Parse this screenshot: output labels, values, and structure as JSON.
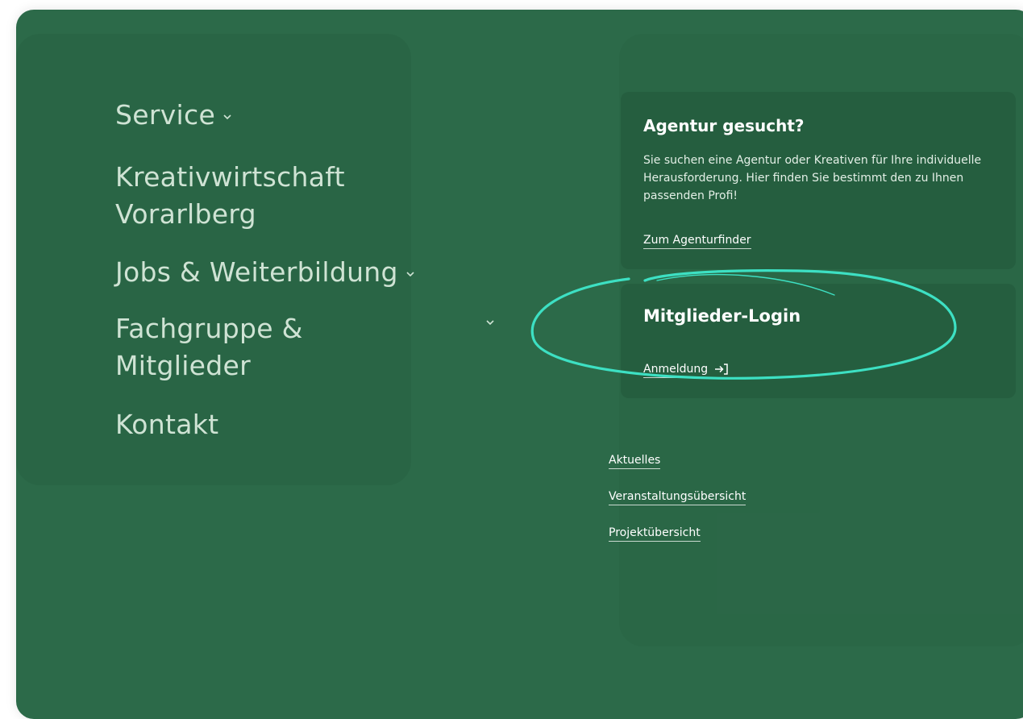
{
  "nav": {
    "service": "Service",
    "kreativwirtschaft": "Kreativwirtschaft Vorarlberg",
    "jobs": "Jobs & Weiterbildung",
    "fachgruppe": "Fachgruppe & Mitglieder",
    "kontakt": "Kontakt"
  },
  "agentur_card": {
    "title": "Agentur gesucht?",
    "text": "Sie suchen eine Agentur oder Kreativen für Ihre individuelle Herausforderung. Hier finden Sie bestimmt den zu Ihnen passenden Profi!",
    "link": "Zum Agenturfinder"
  },
  "login_card": {
    "title": "Mitglieder-Login",
    "link": "Anmeldung",
    "link_icon": "login-arrow-icon"
  },
  "footer_links": {
    "aktuelles": "Aktuelles",
    "veranstaltungen": "Veranstaltungsübersicht",
    "projekte": "Projektübersicht"
  },
  "colors": {
    "background": "#2c6a49",
    "nav_text": "#cfe3d4",
    "annotation": "#3de0c3"
  }
}
